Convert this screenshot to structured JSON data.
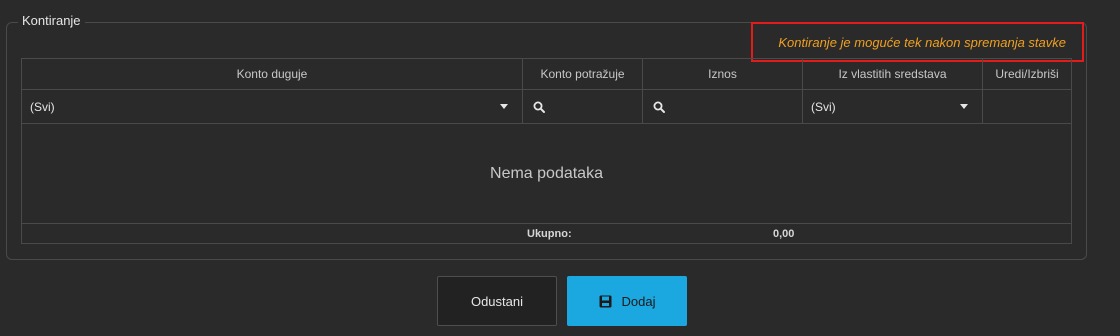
{
  "section": {
    "legend": "Kontiranje",
    "notice": "Kontiranje je moguće tek nakon spremanja stavke"
  },
  "grid": {
    "columns": [
      "Konto duguje",
      "Konto potražuje",
      "Iznos",
      "Iz vlastitih sredstava",
      "Uredi/Izbriši"
    ],
    "filters": {
      "konto_duguje": "(Svi)",
      "iz_vlastitih": "(Svi)"
    },
    "empty_message": "Nema podataka",
    "total_label": "Ukupno:",
    "total_value": "0,00"
  },
  "buttons": {
    "cancel": "Odustani",
    "add": "Dodaj"
  },
  "colors": {
    "background": "#2a2a2a",
    "accent": "#1ba8e0",
    "notice_text": "#f0a020",
    "notice_border": "#e31b1b"
  },
  "icons": [
    "search-icon",
    "chevron-down-icon",
    "save-icon"
  ]
}
